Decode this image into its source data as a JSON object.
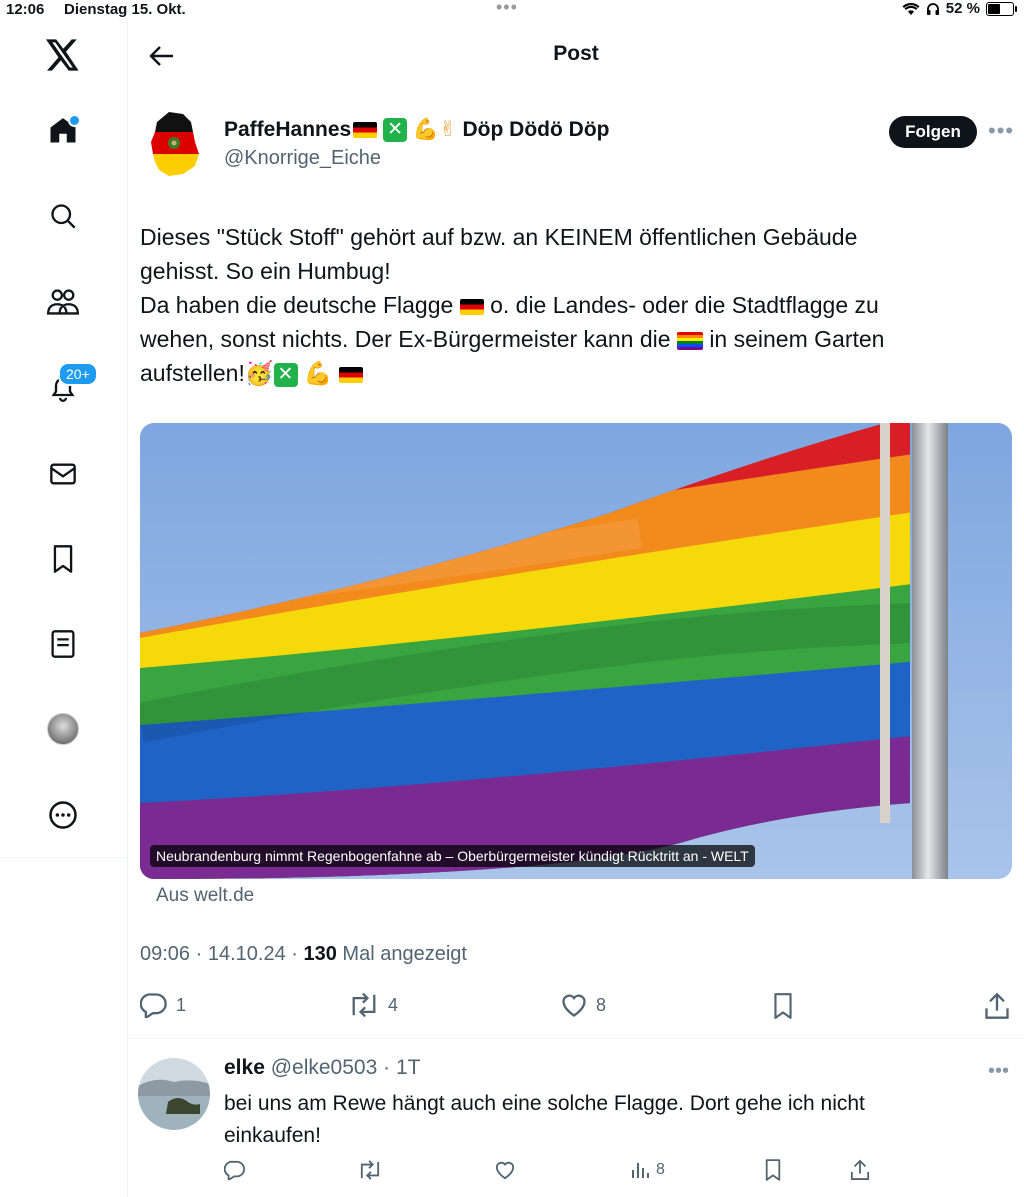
{
  "status_bar": {
    "time": "12:06",
    "date": "Dienstag 15. Okt.",
    "battery": "52 %",
    "battery_level": 0.52
  },
  "sidebar": {
    "items": [
      {
        "icon": "home-icon"
      },
      {
        "icon": "search-icon"
      },
      {
        "icon": "communities-icon"
      },
      {
        "icon": "notifications-icon",
        "badge": "20+"
      },
      {
        "icon": "messages-icon"
      },
      {
        "icon": "bookmarks-icon"
      },
      {
        "icon": "lists-icon"
      },
      {
        "icon": "profile-avatar"
      },
      {
        "icon": "more-icon"
      }
    ]
  },
  "header": {
    "title": "Post"
  },
  "tweet": {
    "author_name": "PaffeHannes",
    "author_name_suffix": "Döp Dödö Döp",
    "author_handle": "@Knorrige_Eiche",
    "follow_label": "Folgen",
    "text_line1": "Dieses \"Stück Stoff\" gehört auf bzw. an KEINEM öffentlichen Gebäude",
    "text_line2": "gehisst. So ein Humbug!",
    "text_line3_a": "Da haben die deutsche Flagge",
    "text_line3_b": "o. die Landes- oder die Stadtflagge zu",
    "text_line4_a": "wehen, sonst nichts. Der Ex-Bürgermeister kann die",
    "text_line4_b": "in seinem Garten",
    "text_line5": "aufstellen!",
    "card_caption": "Neubrandenburg nimmt Regenbogenfahne ab – Oberbürgermeister kündigt Rücktritt an - WELT",
    "card_source": "Aus welt.de",
    "time": "09:06",
    "date": "14.10.24",
    "views": "130",
    "views_label": "Mal angezeigt",
    "replies": "1",
    "reposts": "4",
    "likes": "8"
  },
  "reply": {
    "name": "elke",
    "handle": "@elke0503",
    "age": "1T",
    "text": "bei uns am Rewe hängt auch eine solche Flagge. Dort gehe ich nicht einkaufen!",
    "views": "8"
  }
}
